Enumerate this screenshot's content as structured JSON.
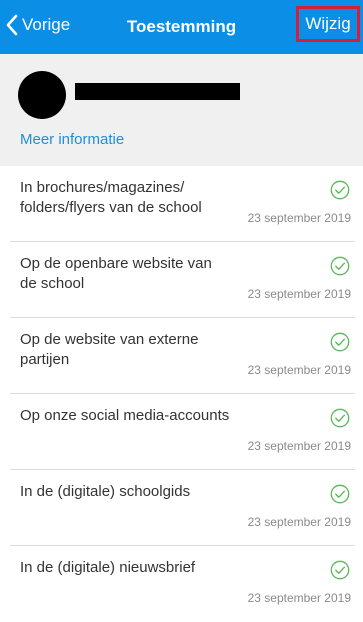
{
  "navbar": {
    "back_label": "Vorige",
    "title": "Toestemming",
    "edit_label": "Wijzig",
    "background_color": "#0a8ee6",
    "highlight_color": "#d41f3b"
  },
  "profile": {
    "more_info_label": "Meer informatie",
    "name_redacted": true
  },
  "consents": [
    {
      "label": "In brochures/magazines/ folders/flyers van de school",
      "date": "23 september 2019",
      "status_icon": "check-circle-icon"
    },
    {
      "label": "Op de openbare website van de school",
      "date": "23 september 2019",
      "status_icon": "check-circle-icon"
    },
    {
      "label": "Op de website van externe partijen",
      "date": "23 september 2019",
      "status_icon": "check-circle-icon"
    },
    {
      "label": "Op onze social media-accounts",
      "date": "23 september 2019",
      "status_icon": "check-circle-icon"
    },
    {
      "label": "In de (digitale) schoolgids",
      "date": "23 september 2019",
      "status_icon": "check-circle-icon"
    },
    {
      "label": "In de (digitale) nieuwsbrief",
      "date": "23 september 2019",
      "status_icon": "check-circle-icon"
    }
  ]
}
